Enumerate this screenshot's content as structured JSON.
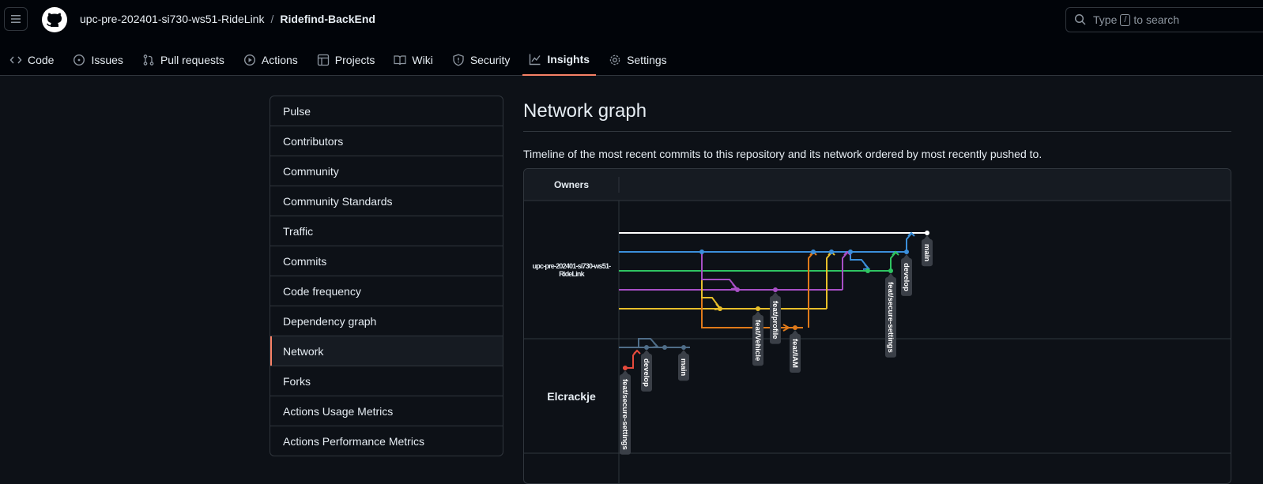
{
  "header": {
    "owner": "upc-pre-202401-si730-ws51-RideLink",
    "separator": "/",
    "repo": "Ridefind-BackEnd",
    "search": {
      "prefix": "Type",
      "key": "/",
      "suffix": "to search"
    }
  },
  "tabs": [
    {
      "label": "Code",
      "icon": "code-icon"
    },
    {
      "label": "Issues",
      "icon": "issue-icon"
    },
    {
      "label": "Pull requests",
      "icon": "pull-request-icon"
    },
    {
      "label": "Actions",
      "icon": "play-icon"
    },
    {
      "label": "Projects",
      "icon": "table-icon"
    },
    {
      "label": "Wiki",
      "icon": "book-icon"
    },
    {
      "label": "Security",
      "icon": "shield-icon"
    },
    {
      "label": "Insights",
      "icon": "graph-icon",
      "active": true
    },
    {
      "label": "Settings",
      "icon": "gear-icon"
    }
  ],
  "sidebar": {
    "items": [
      {
        "label": "Pulse"
      },
      {
        "label": "Contributors"
      },
      {
        "label": "Community"
      },
      {
        "label": "Community Standards"
      },
      {
        "label": "Traffic"
      },
      {
        "label": "Commits"
      },
      {
        "label": "Code frequency"
      },
      {
        "label": "Dependency graph"
      },
      {
        "label": "Network",
        "active": true
      },
      {
        "label": "Forks"
      },
      {
        "label": "Actions Usage Metrics"
      },
      {
        "label": "Actions Performance Metrics"
      }
    ]
  },
  "main": {
    "title": "Network graph",
    "description": "Timeline of the most recent commits to this repository and its network ordered by most recently pushed to."
  },
  "graph": {
    "owners_header": "Owners",
    "owners": [
      "upc-pre-202401-si730-ws51-RideLink",
      "Elcrackje"
    ],
    "branch_labels": {
      "main": "main",
      "develop": "develop",
      "feat_secure_settings": "feat/secure-settings",
      "feat_profile": "feat/profile",
      "feat_vehicle": "feat/Vehicle",
      "feat_iam": "feat/IAM",
      "fork_develop": "develop",
      "fork_main": "main",
      "fork_secure": "feat/secure-settings"
    },
    "colors": {
      "main": "#ffffff",
      "develop": "#3b8fdb",
      "secure": "#2fc462",
      "profile": "#a84fc6",
      "vehicle": "#e8bf2a",
      "iam": "#e07a1a",
      "fork": "#4f6d88",
      "fork_feat": "#e54a3c",
      "fork_head": "#3b8fdb"
    }
  }
}
